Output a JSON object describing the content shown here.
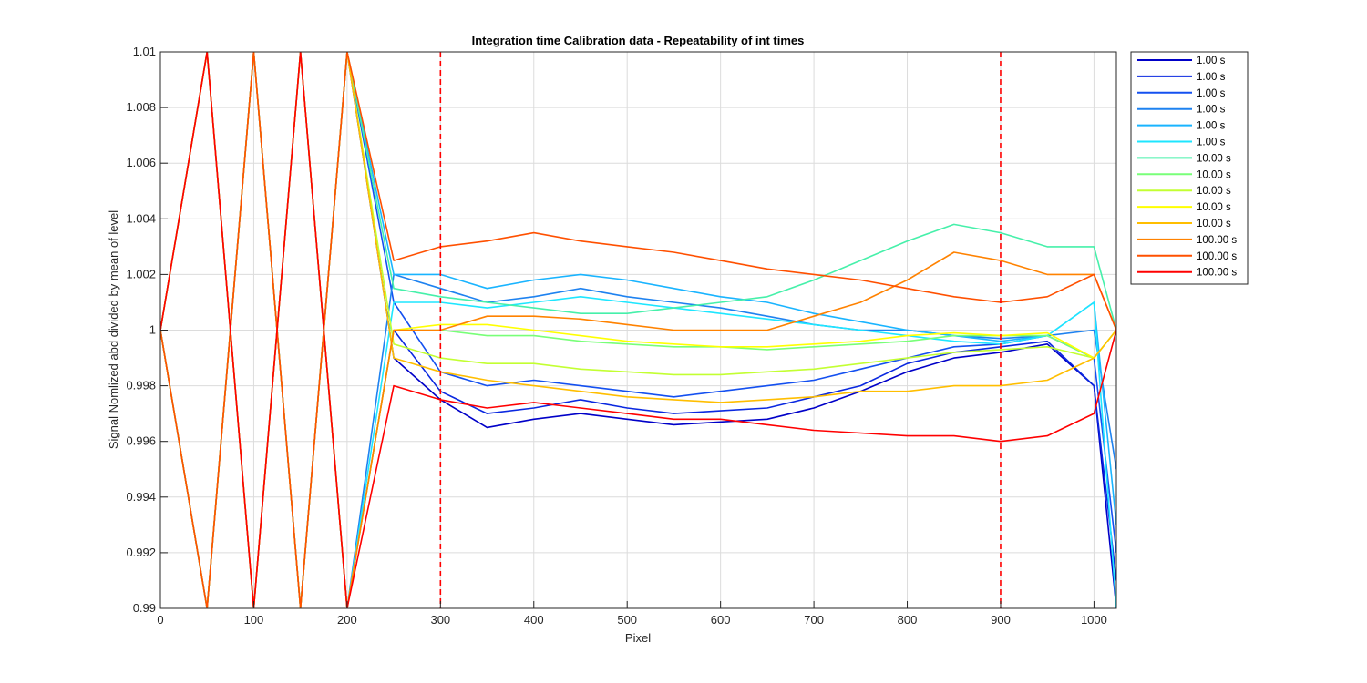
{
  "chart_data": {
    "type": "line",
    "title": "Integration time Calibration data - Repeatability of int times",
    "xlabel": "Pixel",
    "ylabel": "Signal Nomlized abd divided by mean of level",
    "xlim": [
      0,
      1024
    ],
    "ylim": [
      0.99,
      1.01
    ],
    "xticks": [
      0,
      100,
      200,
      300,
      400,
      500,
      600,
      700,
      800,
      900,
      1000
    ],
    "yticks": [
      0.99,
      0.992,
      0.994,
      0.996,
      0.998,
      1,
      1.002,
      1.004,
      1.006,
      1.008,
      1.01
    ],
    "xtick_labels": [
      "0",
      "100",
      "200",
      "300",
      "400",
      "500",
      "600",
      "700",
      "800",
      "900",
      "1000"
    ],
    "ytick_labels": [
      "0.99",
      "0.992",
      "0.994",
      "0.996",
      "0.998",
      "1",
      "1.002",
      "1.004",
      "1.006",
      "1.008",
      "1.01"
    ],
    "grid": true,
    "legend_position": "outside-top-right",
    "vertical_markers": [
      {
        "x": 300,
        "color": "#ff0000",
        "style": "dashed"
      },
      {
        "x": 900,
        "color": "#ff0000",
        "style": "dashed"
      }
    ],
    "x": [
      0,
      50,
      100,
      150,
      200,
      250,
      300,
      350,
      400,
      450,
      500,
      550,
      600,
      650,
      700,
      750,
      800,
      850,
      900,
      950,
      1000,
      1024
    ],
    "series": [
      {
        "name": "1.00 s",
        "color": "#0000c8",
        "values": [
          1.0,
          0.99,
          1.01,
          0.99,
          1.01,
          0.999,
          0.9975,
          0.9965,
          0.9968,
          0.997,
          0.9968,
          0.9966,
          0.9967,
          0.9968,
          0.9972,
          0.9978,
          0.9985,
          0.999,
          0.9992,
          0.9995,
          0.998,
          0.99
        ]
      },
      {
        "name": "1.00 s",
        "color": "#0a28e0",
        "values": [
          1.0,
          1.01,
          0.99,
          1.01,
          0.99,
          1.0,
          0.9978,
          0.997,
          0.9972,
          0.9975,
          0.9972,
          0.997,
          0.9971,
          0.9972,
          0.9976,
          0.998,
          0.9988,
          0.9992,
          0.9994,
          0.9996,
          0.998,
          0.991
        ]
      },
      {
        "name": "1.00 s",
        "color": "#1450f0",
        "values": [
          1.0,
          0.99,
          1.01,
          0.99,
          1.01,
          1.001,
          0.9985,
          0.998,
          0.9982,
          0.998,
          0.9978,
          0.9976,
          0.9978,
          0.998,
          0.9982,
          0.9986,
          0.999,
          0.9994,
          0.9995,
          0.9998,
          0.999,
          0.992
        ]
      },
      {
        "name": "1.00 s",
        "color": "#1e82f0",
        "values": [
          1.0,
          1.01,
          0.99,
          1.01,
          0.99,
          1.002,
          1.0015,
          1.001,
          1.0012,
          1.0015,
          1.0012,
          1.001,
          1.0008,
          1.0005,
          1.0002,
          1.0,
          1.0,
          0.9998,
          0.9997,
          0.9998,
          1.0,
          0.995
        ]
      },
      {
        "name": "1.00 s",
        "color": "#19b4ff",
        "values": [
          1.0,
          0.99,
          1.01,
          0.99,
          1.01,
          1.002,
          1.002,
          1.0015,
          1.0018,
          1.002,
          1.0018,
          1.0015,
          1.0012,
          1.001,
          1.0006,
          1.0003,
          1.0,
          0.9998,
          0.9996,
          0.9998,
          1.001,
          0.993
        ]
      },
      {
        "name": "1.00 s",
        "color": "#1ee6ff",
        "values": [
          1.0,
          1.01,
          0.99,
          1.01,
          0.99,
          1.001,
          1.001,
          1.0008,
          1.001,
          1.0012,
          1.001,
          1.0008,
          1.0006,
          1.0004,
          1.0002,
          1.0,
          0.9998,
          0.9996,
          0.9995,
          0.9998,
          1.001,
          0.99
        ]
      },
      {
        "name": "10.00 s",
        "color": "#46f0aa",
        "values": [
          1.0,
          0.99,
          1.01,
          0.99,
          1.01,
          1.0015,
          1.0012,
          1.001,
          1.0008,
          1.0006,
          1.0006,
          1.0008,
          1.001,
          1.0012,
          1.0018,
          1.0025,
          1.0032,
          1.0038,
          1.0035,
          1.003,
          1.003,
          1.0
        ]
      },
      {
        "name": "10.00 s",
        "color": "#78ff78",
        "values": [
          1.0,
          1.01,
          0.99,
          1.01,
          0.99,
          1.0,
          1.0,
          0.9998,
          0.9998,
          0.9996,
          0.9995,
          0.9994,
          0.9994,
          0.9993,
          0.9994,
          0.9995,
          0.9996,
          0.9998,
          0.9998,
          0.9998,
          0.999,
          1.0
        ]
      },
      {
        "name": "10.00 s",
        "color": "#c3ff32",
        "values": [
          1.0,
          0.99,
          1.01,
          0.99,
          1.01,
          0.9995,
          0.999,
          0.9988,
          0.9988,
          0.9986,
          0.9985,
          0.9984,
          0.9984,
          0.9985,
          0.9986,
          0.9988,
          0.999,
          0.9992,
          0.9993,
          0.9994,
          0.999,
          1.0
        ]
      },
      {
        "name": "10.00 s",
        "color": "#ffff00",
        "values": [
          1.0,
          1.01,
          0.99,
          1.01,
          0.99,
          1.0,
          1.0002,
          1.0002,
          1.0,
          0.9998,
          0.9996,
          0.9995,
          0.9994,
          0.9994,
          0.9995,
          0.9996,
          0.9998,
          0.9999,
          0.9998,
          0.9999,
          0.999,
          1.0
        ]
      },
      {
        "name": "10.00 s",
        "color": "#ffbe00",
        "values": [
          1.0,
          0.99,
          1.01,
          0.99,
          1.01,
          0.999,
          0.9985,
          0.9982,
          0.998,
          0.9978,
          0.9976,
          0.9975,
          0.9974,
          0.9975,
          0.9976,
          0.9978,
          0.9978,
          0.998,
          0.998,
          0.9982,
          0.999,
          1.0
        ]
      },
      {
        "name": "100.00 s",
        "color": "#ff8200",
        "values": [
          1.0,
          1.01,
          0.99,
          1.01,
          0.99,
          1.0,
          1.0,
          1.0005,
          1.0005,
          1.0004,
          1.0002,
          1.0,
          1.0,
          1.0,
          1.0005,
          1.001,
          1.0018,
          1.0028,
          1.0025,
          1.002,
          1.002,
          1.0
        ]
      },
      {
        "name": "100.00 s",
        "color": "#ff5000",
        "values": [
          1.0,
          0.99,
          1.01,
          0.99,
          1.01,
          1.0025,
          1.003,
          1.0032,
          1.0035,
          1.0032,
          1.003,
          1.0028,
          1.0025,
          1.0022,
          1.002,
          1.0018,
          1.0015,
          1.0012,
          1.001,
          1.0012,
          1.002,
          1.0
        ]
      },
      {
        "name": "100.00 s",
        "color": "#ff0000",
        "values": [
          1.0,
          1.01,
          0.99,
          1.01,
          0.99,
          0.998,
          0.9975,
          0.9972,
          0.9974,
          0.9972,
          0.997,
          0.9968,
          0.9968,
          0.9966,
          0.9964,
          0.9963,
          0.9962,
          0.9962,
          0.996,
          0.9962,
          0.997,
          1.0
        ]
      }
    ]
  }
}
